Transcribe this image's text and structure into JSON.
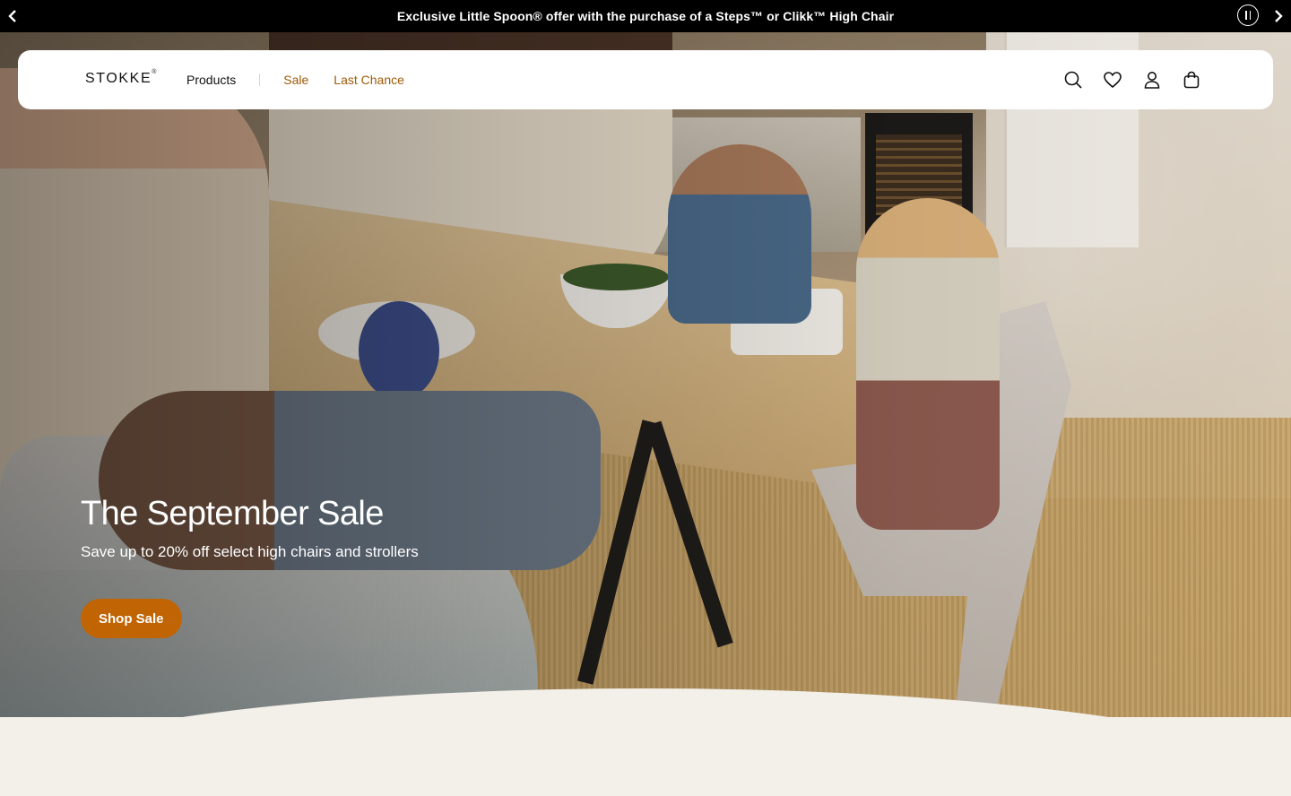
{
  "announcement": {
    "text": "Exclusive Little Spoon® offer with the purchase of a Steps™ or Clikk™ High Chair",
    "prev_icon": "chevron-left-icon",
    "next_icon": "chevron-right-icon",
    "pause_icon": "pause-icon"
  },
  "header": {
    "logo": "STOKKE",
    "logo_mark": "®",
    "nav": {
      "products": "Products",
      "sale": "Sale",
      "last_chance": "Last Chance"
    },
    "icons": [
      "search-icon",
      "heart-icon",
      "user-icon",
      "bag-icon"
    ]
  },
  "hero": {
    "title": "The September Sale",
    "subtitle": "Save up to 20% off select high chairs and strollers",
    "cta": "Shop Sale"
  },
  "colors": {
    "accent": "#c06404",
    "sale_link": "#a05a06",
    "announcement_bg": "#000000",
    "page_bg": "#f3efe9"
  }
}
